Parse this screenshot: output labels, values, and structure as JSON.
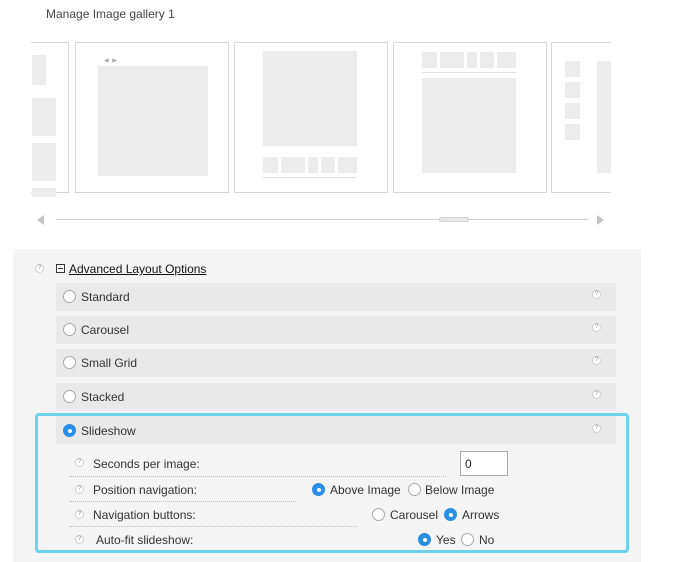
{
  "page": {
    "title": "Manage Image gallery 1"
  },
  "advanced": {
    "heading": "Advanced Layout Options",
    "help_glyph": "?",
    "options": [
      {
        "label": "Standard",
        "selected": false
      },
      {
        "label": "Carousel",
        "selected": false
      },
      {
        "label": "Small Grid",
        "selected": false
      },
      {
        "label": "Stacked",
        "selected": false
      },
      {
        "label": "Slideshow",
        "selected": true
      }
    ]
  },
  "slideshow": {
    "seconds": {
      "label": "Seconds per image:",
      "value": "0"
    },
    "position": {
      "label": "Position navigation:",
      "choices": [
        "Above Image",
        "Below Image"
      ],
      "selected": "Above Image"
    },
    "buttons": {
      "label": "Navigation buttons:",
      "choices": [
        "Carousel",
        "Arrows"
      ],
      "selected": "Arrows"
    },
    "autofit": {
      "label": "Auto-fit slideshow:",
      "choices": [
        "Yes",
        "No"
      ],
      "selected": "Yes"
    }
  },
  "colors": {
    "accent": "#2b8ee6",
    "highlight": "#6dd3ea",
    "panel": "#f4f4f4",
    "row": "#e9e9e9"
  },
  "icons": [
    "help-icon",
    "collapse-icon",
    "scroll-left-arrow-icon",
    "scroll-right-arrow-icon"
  ]
}
